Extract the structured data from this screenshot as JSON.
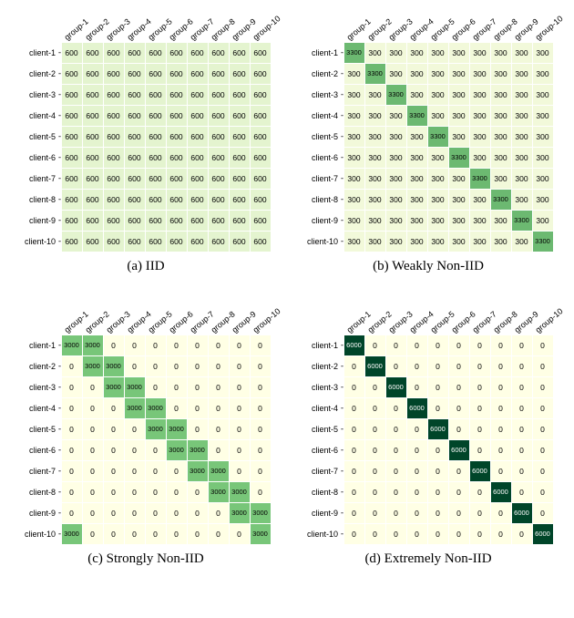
{
  "groups": [
    "group-1",
    "group-2",
    "group-3",
    "group-4",
    "group-5",
    "group-6",
    "group-7",
    "group-8",
    "group-9",
    "group-10"
  ],
  "clients": [
    "client-1",
    "client-2",
    "client-3",
    "client-4",
    "client-5",
    "client-6",
    "client-7",
    "client-8",
    "client-9",
    "client-10"
  ],
  "panels": [
    {
      "key": "a",
      "caption": "(a) IID"
    },
    {
      "key": "b",
      "caption": "(b) Weakly Non-IID"
    },
    {
      "key": "c",
      "caption": "(c) Strongly Non-IID"
    },
    {
      "key": "d",
      "caption": "(d) Extremely Non-IID"
    }
  ],
  "colormap": {
    "min_hex": "#ffffe5",
    "mid_hex": "#78c679",
    "max_hex": "#004529",
    "scale_max": 6000
  },
  "chart_data": [
    {
      "type": "heatmap",
      "title": "(a) IID",
      "x_labels": [
        "group-1",
        "group-2",
        "group-3",
        "group-4",
        "group-5",
        "group-6",
        "group-7",
        "group-8",
        "group-9",
        "group-10"
      ],
      "y_labels": [
        "client-1",
        "client-2",
        "client-3",
        "client-4",
        "client-5",
        "client-6",
        "client-7",
        "client-8",
        "client-9",
        "client-10"
      ],
      "matrix": [
        [
          600,
          600,
          600,
          600,
          600,
          600,
          600,
          600,
          600,
          600
        ],
        [
          600,
          600,
          600,
          600,
          600,
          600,
          600,
          600,
          600,
          600
        ],
        [
          600,
          600,
          600,
          600,
          600,
          600,
          600,
          600,
          600,
          600
        ],
        [
          600,
          600,
          600,
          600,
          600,
          600,
          600,
          600,
          600,
          600
        ],
        [
          600,
          600,
          600,
          600,
          600,
          600,
          600,
          600,
          600,
          600
        ],
        [
          600,
          600,
          600,
          600,
          600,
          600,
          600,
          600,
          600,
          600
        ],
        [
          600,
          600,
          600,
          600,
          600,
          600,
          600,
          600,
          600,
          600
        ],
        [
          600,
          600,
          600,
          600,
          600,
          600,
          600,
          600,
          600,
          600
        ],
        [
          600,
          600,
          600,
          600,
          600,
          600,
          600,
          600,
          600,
          600
        ],
        [
          600,
          600,
          600,
          600,
          600,
          600,
          600,
          600,
          600,
          600
        ]
      ],
      "value_range": [
        0,
        6000
      ]
    },
    {
      "type": "heatmap",
      "title": "(b) Weakly Non-IID",
      "x_labels": [
        "group-1",
        "group-2",
        "group-3",
        "group-4",
        "group-5",
        "group-6",
        "group-7",
        "group-8",
        "group-9",
        "group-10"
      ],
      "y_labels": [
        "client-1",
        "client-2",
        "client-3",
        "client-4",
        "client-5",
        "client-6",
        "client-7",
        "client-8",
        "client-9",
        "client-10"
      ],
      "matrix": [
        [
          3300,
          300,
          300,
          300,
          300,
          300,
          300,
          300,
          300,
          300
        ],
        [
          300,
          3300,
          300,
          300,
          300,
          300,
          300,
          300,
          300,
          300
        ],
        [
          300,
          300,
          3300,
          300,
          300,
          300,
          300,
          300,
          300,
          300
        ],
        [
          300,
          300,
          300,
          3300,
          300,
          300,
          300,
          300,
          300,
          300
        ],
        [
          300,
          300,
          300,
          300,
          3300,
          300,
          300,
          300,
          300,
          300
        ],
        [
          300,
          300,
          300,
          300,
          300,
          3300,
          300,
          300,
          300,
          300
        ],
        [
          300,
          300,
          300,
          300,
          300,
          300,
          3300,
          300,
          300,
          300
        ],
        [
          300,
          300,
          300,
          300,
          300,
          300,
          300,
          3300,
          300,
          300
        ],
        [
          300,
          300,
          300,
          300,
          300,
          300,
          300,
          300,
          3300,
          300
        ],
        [
          300,
          300,
          300,
          300,
          300,
          300,
          300,
          300,
          300,
          3300
        ]
      ],
      "value_range": [
        0,
        6000
      ]
    },
    {
      "type": "heatmap",
      "title": "(c) Strongly Non-IID",
      "x_labels": [
        "group-1",
        "group-2",
        "group-3",
        "group-4",
        "group-5",
        "group-6",
        "group-7",
        "group-8",
        "group-9",
        "group-10"
      ],
      "y_labels": [
        "client-1",
        "client-2",
        "client-3",
        "client-4",
        "client-5",
        "client-6",
        "client-7",
        "client-8",
        "client-9",
        "client-10"
      ],
      "matrix": [
        [
          3000,
          3000,
          0,
          0,
          0,
          0,
          0,
          0,
          0,
          0
        ],
        [
          0,
          3000,
          3000,
          0,
          0,
          0,
          0,
          0,
          0,
          0
        ],
        [
          0,
          0,
          3000,
          3000,
          0,
          0,
          0,
          0,
          0,
          0
        ],
        [
          0,
          0,
          0,
          3000,
          3000,
          0,
          0,
          0,
          0,
          0
        ],
        [
          0,
          0,
          0,
          0,
          3000,
          3000,
          0,
          0,
          0,
          0
        ],
        [
          0,
          0,
          0,
          0,
          0,
          3000,
          3000,
          0,
          0,
          0
        ],
        [
          0,
          0,
          0,
          0,
          0,
          0,
          3000,
          3000,
          0,
          0
        ],
        [
          0,
          0,
          0,
          0,
          0,
          0,
          0,
          3000,
          3000,
          0
        ],
        [
          0,
          0,
          0,
          0,
          0,
          0,
          0,
          0,
          3000,
          3000
        ],
        [
          3000,
          0,
          0,
          0,
          0,
          0,
          0,
          0,
          0,
          3000
        ]
      ],
      "value_range": [
        0,
        6000
      ]
    },
    {
      "type": "heatmap",
      "title": "(d) Extremely Non-IID",
      "x_labels": [
        "group-1",
        "group-2",
        "group-3",
        "group-4",
        "group-5",
        "group-6",
        "group-7",
        "group-8",
        "group-9",
        "group-10"
      ],
      "y_labels": [
        "client-1",
        "client-2",
        "client-3",
        "client-4",
        "client-5",
        "client-6",
        "client-7",
        "client-8",
        "client-9",
        "client-10"
      ],
      "matrix": [
        [
          6000,
          0,
          0,
          0,
          0,
          0,
          0,
          0,
          0,
          0
        ],
        [
          0,
          6000,
          0,
          0,
          0,
          0,
          0,
          0,
          0,
          0
        ],
        [
          0,
          0,
          6000,
          0,
          0,
          0,
          0,
          0,
          0,
          0
        ],
        [
          0,
          0,
          0,
          6000,
          0,
          0,
          0,
          0,
          0,
          0
        ],
        [
          0,
          0,
          0,
          0,
          6000,
          0,
          0,
          0,
          0,
          0
        ],
        [
          0,
          0,
          0,
          0,
          0,
          6000,
          0,
          0,
          0,
          0
        ],
        [
          0,
          0,
          0,
          0,
          0,
          0,
          6000,
          0,
          0,
          0
        ],
        [
          0,
          0,
          0,
          0,
          0,
          0,
          0,
          6000,
          0,
          0
        ],
        [
          0,
          0,
          0,
          0,
          0,
          0,
          0,
          0,
          6000,
          0
        ],
        [
          0,
          0,
          0,
          0,
          0,
          0,
          0,
          0,
          0,
          6000
        ]
      ],
      "value_range": [
        0,
        6000
      ]
    }
  ]
}
